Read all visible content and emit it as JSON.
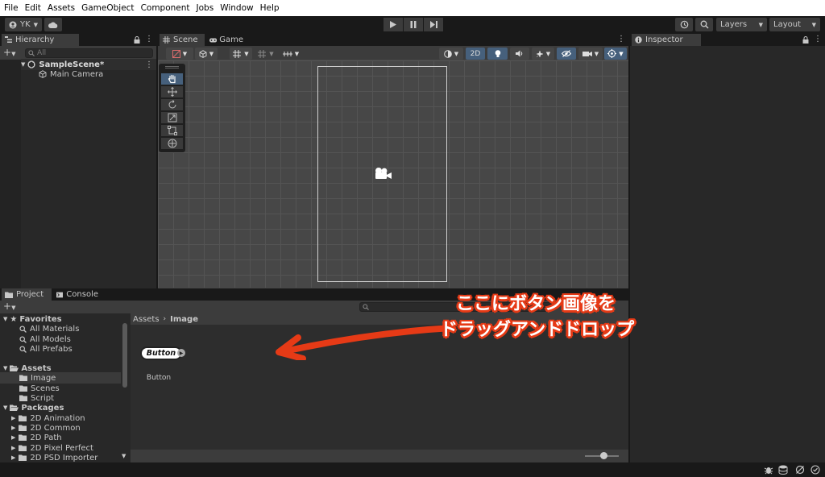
{
  "menu": [
    "File",
    "Edit",
    "Assets",
    "GameObject",
    "Component",
    "Jobs",
    "Window",
    "Help"
  ],
  "toolbar": {
    "account_label": "YK",
    "layers_label": "Layers",
    "layout_label": "Layout"
  },
  "hierarchy": {
    "tab_label": "Hierarchy",
    "search_placeholder": "All",
    "scene_name": "SampleScene*",
    "items": [
      "Main Camera"
    ]
  },
  "scene": {
    "tabs": [
      "Scene",
      "Game"
    ],
    "mode_2d_label": "2D"
  },
  "inspector": {
    "tab_label": "Inspector"
  },
  "project": {
    "tabs": [
      "Project",
      "Console"
    ],
    "favorites_label": "Favorites",
    "favorites": [
      "All Materials",
      "All Models",
      "All Prefabs"
    ],
    "assets_label": "Assets",
    "assets": [
      "Image",
      "Scenes",
      "Script"
    ],
    "packages_label": "Packages",
    "packages": [
      "2D Animation",
      "2D Common",
      "2D Path",
      "2D Pixel Perfect",
      "2D PSD Importer"
    ],
    "breadcrumb": [
      "Assets",
      "Image"
    ],
    "asset_item_graphic_text": "Button",
    "asset_item_label": "Button",
    "slider_value": 0.55
  },
  "annotation": {
    "line1": "ここにボタン画像を",
    "line2": "ドラッグアンドドロップ",
    "color": "#e63a16"
  }
}
